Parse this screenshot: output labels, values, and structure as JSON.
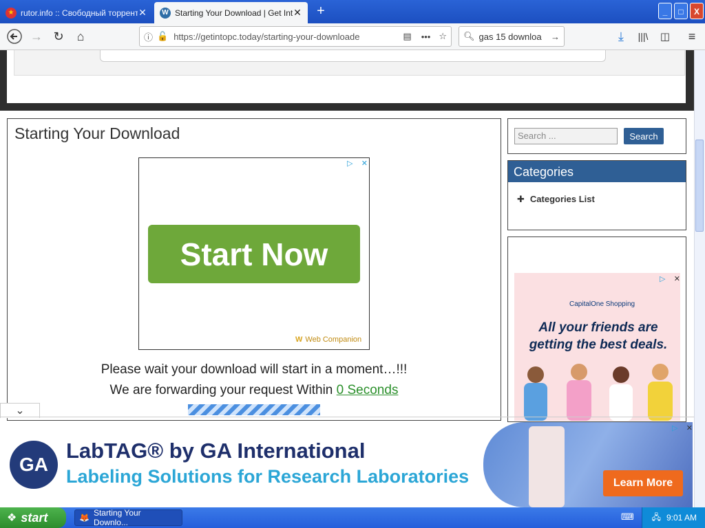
{
  "browser": {
    "tabs": [
      {
        "label": "rutor.info :: Свободный торрент",
        "active": false
      },
      {
        "label": "Starting Your Download | Get Into",
        "active": true
      }
    ],
    "url": "https://getintopc.today/starting-your-downloade",
    "search_query": "gas 15 downloa",
    "new_tab_symbol": "+",
    "window_buttons": {
      "minimize": "_",
      "maximize": "□",
      "close": "X"
    }
  },
  "main": {
    "title": "Starting Your Download",
    "ad": {
      "cta": "Start Now",
      "brand": "Web Companion"
    },
    "wait_message": "Please wait your download will start in a moment…!!!",
    "forward_prefix": "We are forwarding your request Within ",
    "forward_seconds": "0 Seconds"
  },
  "sidebar": {
    "search_placeholder": "Search ...",
    "search_button": "Search",
    "categories_title": "Categories",
    "categories_item": "Categories List",
    "ad": {
      "brand": "CapitalOne Shopping",
      "headline": "All your friends are getting the best deals."
    }
  },
  "bottom_ad": {
    "logo": "GA",
    "title": "LabTAG® by GA International",
    "subtitle": "Labeling Solutions for Research Laboratories",
    "cta": "Learn More"
  },
  "taskbar": {
    "start": "start",
    "task": "Starting Your Downlo...",
    "time": "9:01 AM"
  },
  "colors": {
    "accent": "#2f5f95",
    "start_now": "#6ea83a",
    "learn_more": "#ef6a1d"
  }
}
